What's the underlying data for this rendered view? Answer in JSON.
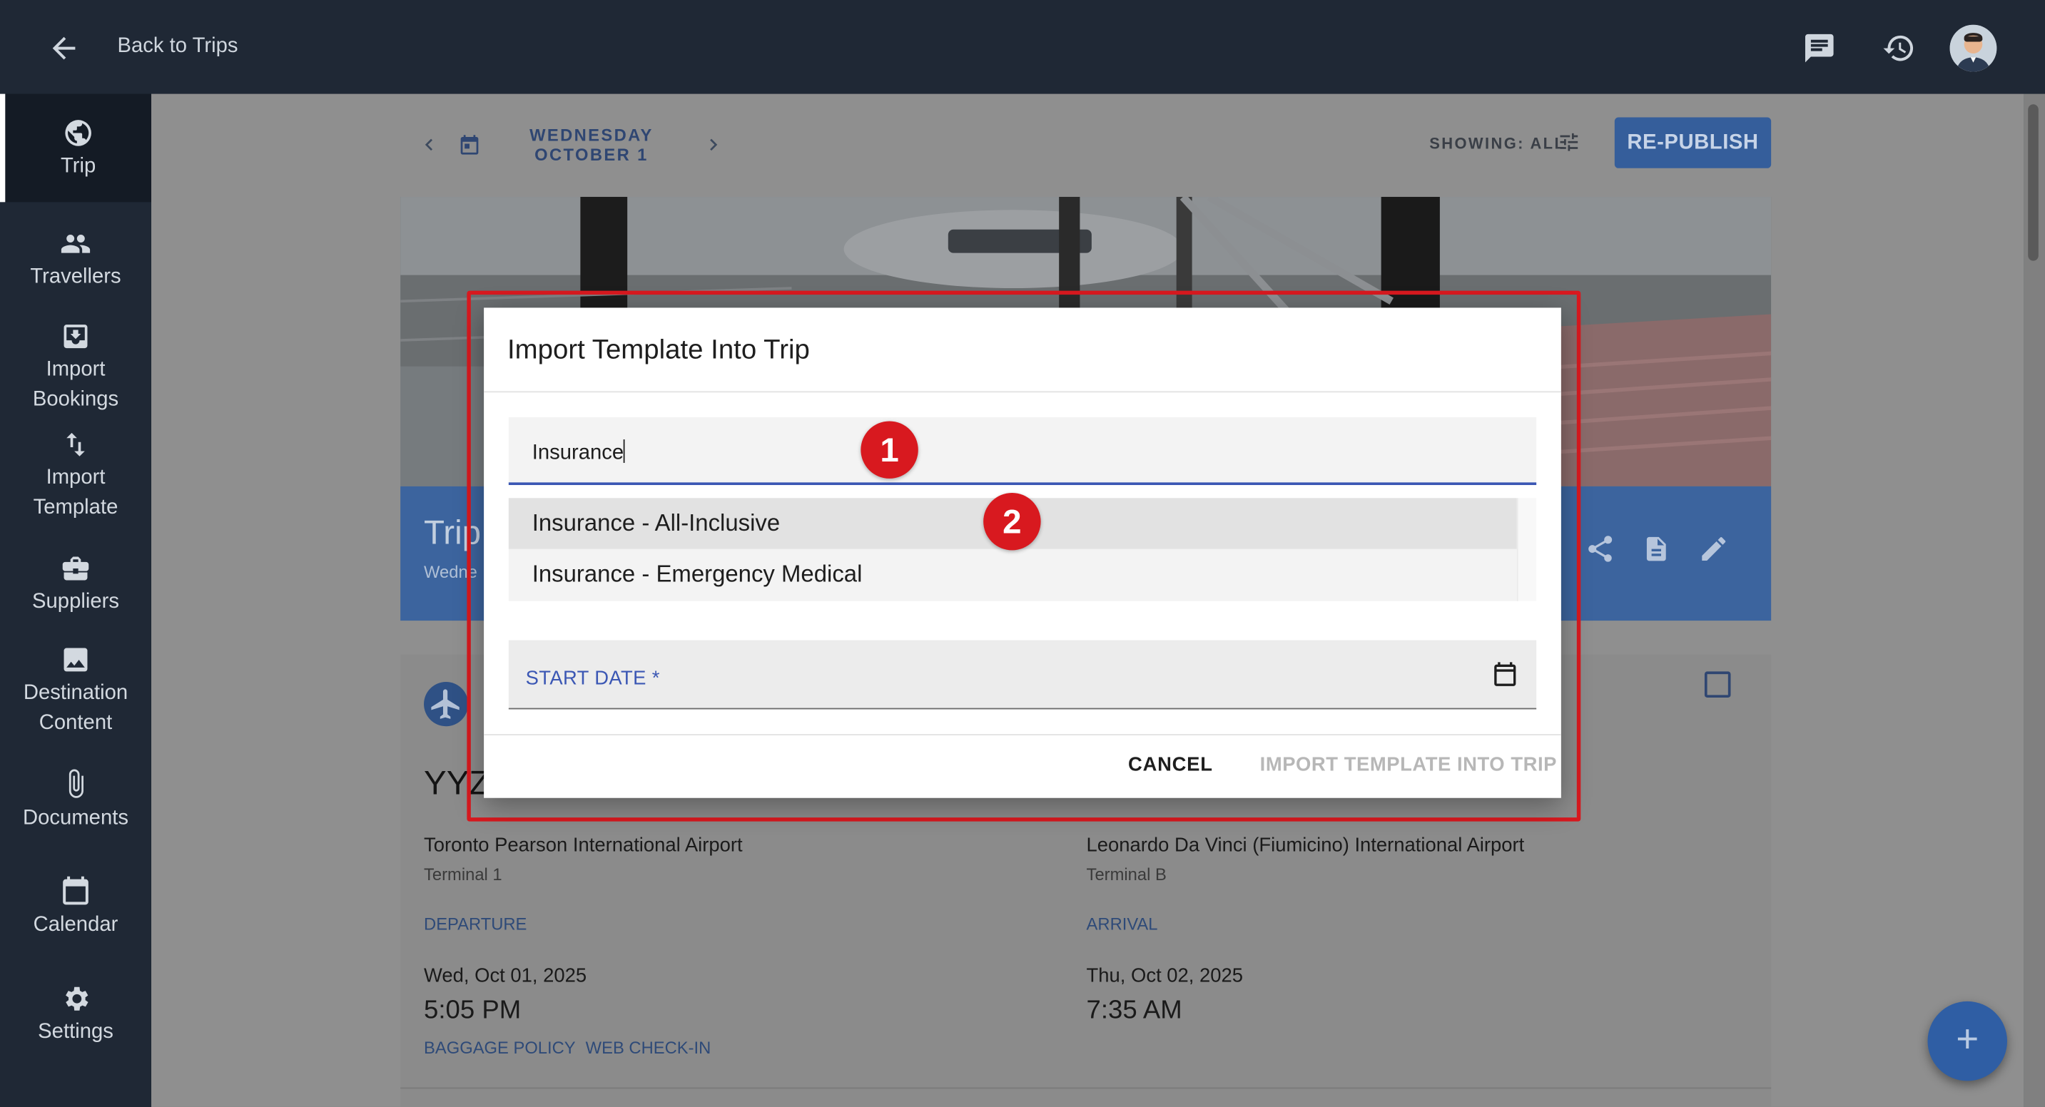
{
  "topbar": {
    "back_label": "Back to Trips",
    "icons": [
      "back-arrow-icon",
      "chat-icon",
      "history-icon",
      "avatar"
    ]
  },
  "sidebar": {
    "items": [
      {
        "label": "Trip",
        "icon": "globe-icon"
      },
      {
        "label": "Travellers",
        "icon": "people-icon"
      },
      {
        "label": "Import Bookings",
        "icon": "import-icon"
      },
      {
        "label": "Import Template",
        "icon": "swap-vertical-icon"
      },
      {
        "label": "Suppliers",
        "icon": "briefcase-icon"
      },
      {
        "label": "Destination Content",
        "icon": "image-icon"
      },
      {
        "label": "Documents",
        "icon": "paperclip-icon"
      },
      {
        "label": "Calendar",
        "icon": "calendar-icon"
      },
      {
        "label": "Settings",
        "icon": "gear-icon"
      }
    ]
  },
  "daynav": {
    "day": "WEDNESDAY",
    "date": "OCTOBER 1",
    "showing": "SHOWING: ALL",
    "republish": "RE-PUBLISH"
  },
  "trip": {
    "title_partial": "Trip",
    "sub_partial": "Wedne"
  },
  "flight": {
    "code_partial": "YYZ",
    "from_airport": "Toronto Pearson International Airport",
    "from_terminal": "Terminal 1",
    "departure_label": "DEPARTURE",
    "depart_date": "Wed, Oct 01, 2025",
    "depart_time": "5:05 PM",
    "baggage_link": "BAGGAGE POLICY",
    "checkin_link": "WEB CHECK-IN",
    "to_airport": "Leonardo Da Vinci (Fiumicino) International Airport",
    "to_terminal": "Terminal B",
    "arrival_label": "ARRIVAL",
    "arrive_date": "Thu, Oct 02, 2025",
    "arrive_time": "7:35 AM"
  },
  "dialog": {
    "title": "Import Template Into Trip",
    "search_value": "Insurance",
    "options": [
      "Insurance - All-Inclusive",
      "Insurance - Emergency Medical"
    ],
    "start_date_label": "START DATE *",
    "cancel": "CANCEL",
    "import": "IMPORT TEMPLATE INTO TRIP"
  },
  "annotations": {
    "badge_1": "1",
    "badge_2": "2",
    "highlight_color": "#d8191f"
  },
  "fab": {
    "label": "+"
  }
}
